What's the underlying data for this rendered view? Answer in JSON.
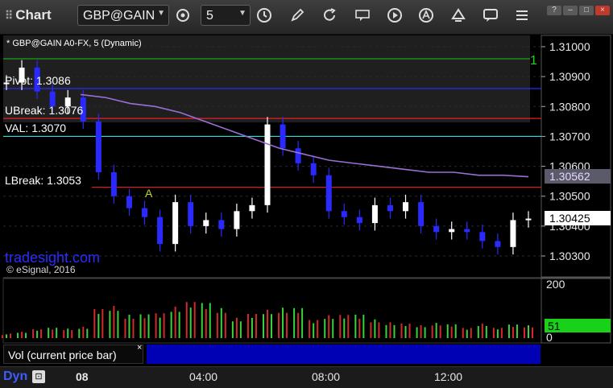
{
  "toolbar": {
    "title": "Chart",
    "symbol": "GBP@GAIN",
    "interval": "5"
  },
  "window_buttons": [
    "?",
    "–",
    "□",
    "×"
  ],
  "chart": {
    "symbol_label": "* GBP@GAIN A0-FX, 5 (Dynamic)",
    "brand": "tradesight.com",
    "copyright": "© eSignal, 2016",
    "y_ticks": [
      "1.31000",
      "1.30900",
      "1.30800",
      "1.30700",
      "1.30600",
      "1.30500",
      "1.30400",
      "1.30300"
    ],
    "avg_price_tag": "1.30562",
    "last_price_tag": "1.30425",
    "levels": [
      {
        "label": "Pivot: 1.3086",
        "value": 1.3086,
        "color": "#2a2aff"
      },
      {
        "label": "UBreak: 1.3076",
        "value": 1.3076,
        "color": "#e02020"
      },
      {
        "label": "VAL: 1.3070",
        "value": 1.307,
        "color": "#33dddd"
      },
      {
        "label": "LBreak: 1.3053",
        "value": 1.3053,
        "color": "#e02020"
      }
    ],
    "top_level_label": "1",
    "marker_label": "A",
    "volume": {
      "ticks": [
        "200",
        "0"
      ],
      "current_value": "51",
      "label": "Vol (current price bar)",
      "close_label": "×"
    }
  },
  "bottom": {
    "dyn_label": "Dyn",
    "x_ticks": [
      "08",
      "04:00",
      "08:00",
      "12:00"
    ]
  },
  "colors": {
    "bar_up": "#ffffff",
    "bar_down": "#2a2aff",
    "ma_line": "#9b6fd6",
    "volume_up": "#3ad13a",
    "volume_down": "#d22a2a",
    "volume_current": "#19d119"
  },
  "chart_data": {
    "type": "bar",
    "ylim": [
      1.3026,
      1.3105
    ],
    "series_ma": [
      1.3084,
      1.3083,
      1.3081,
      1.308,
      1.3078,
      1.3075,
      1.3072,
      1.3069,
      1.3066,
      1.3064,
      1.3062,
      1.3061,
      1.306,
      1.3059,
      1.3058,
      1.3058,
      1.3057,
      1.3057,
      1.30565
    ],
    "close_points": [
      1.3088,
      1.3093,
      1.3085,
      1.308,
      1.3083,
      1.3075,
      1.3058,
      1.305,
      1.3046,
      1.3043,
      1.3034,
      1.3048,
      1.304,
      1.3042,
      1.3039,
      1.3045,
      1.3047,
      1.3074,
      1.3066,
      1.3061,
      1.3057,
      1.3045,
      1.3043,
      1.3041,
      1.3047,
      1.3045,
      1.3048,
      1.304,
      1.3038,
      1.3039,
      1.3038,
      1.3035,
      1.3033,
      1.3042,
      1.30425
    ],
    "volume_values": [
      20,
      26,
      34,
      44,
      38,
      50,
      120,
      125,
      100,
      95,
      110,
      130,
      140,
      150,
      120,
      90,
      100,
      110,
      130,
      120,
      80,
      95,
      90,
      100,
      75,
      70,
      60,
      50,
      65,
      55,
      45,
      60,
      40,
      58,
      51
    ]
  }
}
